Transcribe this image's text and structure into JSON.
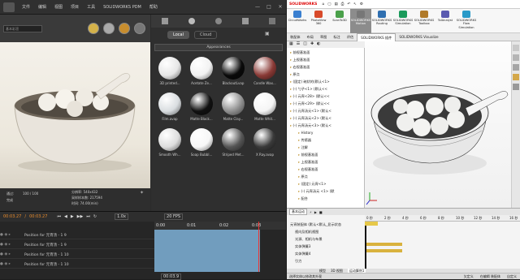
{
  "left_app": {
    "menu": [
      "文件",
      "编辑",
      "视图",
      "项目",
      "工具",
      "SOLIDWORKS PDM",
      "帮助"
    ],
    "window_controls": [
      "—",
      "□",
      "✕"
    ],
    "style_dropdown": "基本彩渲",
    "library": {
      "tabs": [
        "Local",
        "Cloud"
      ],
      "section": "Appearances",
      "materials": [
        {
          "label": "3D printed...",
          "color": "#e6e6e6"
        },
        {
          "label": "Acetate Ze...",
          "color": "#f2f2f2"
        },
        {
          "label": "BlackoutLvap",
          "color": "#0a0a0a"
        },
        {
          "label": "Candle Wax...",
          "color": "#8a3a36"
        },
        {
          "label": "Film.avap",
          "color": "#d9dde0"
        },
        {
          "label": "Matte Black...",
          "color": "#111111"
        },
        {
          "label": "Matte Clay...",
          "color": "#8f8f8f"
        },
        {
          "label": "Matte Whit...",
          "color": "#f5f5f5"
        },
        {
          "label": "Smooth Wh...",
          "color": "#dddddd"
        },
        {
          "label": "Soap Bubbl...",
          "color": "#f7f7f7"
        },
        {
          "label": "Striped Met...",
          "color": "#555555"
        },
        {
          "label": "X Ray.avap",
          "color": "#3a3a3a"
        }
      ]
    },
    "status": {
      "pass_label": "通过:",
      "pass_value": "100 / 100",
      "done": "完成",
      "resolution": "分辨率: 540x432",
      "samples": "采样样本数: 217594",
      "time": "时间: 74.00(min)"
    },
    "timeline": {
      "time_start": "00:03.27",
      "time_end": "00:03.27",
      "zoom": "1.0x",
      "fps": "20 FPS",
      "ticks": [
        "0:00",
        "0:01",
        "0:02",
        "0:03"
      ],
      "rows": [
        "Position for 元宵汤 - 1 9",
        "Position for 元宵汤 - 1 9",
        "Position for 元宵汤 - 1 10",
        "Position for 元宵汤 - 1 10"
      ],
      "bottom_time": "00:03.9"
    }
  },
  "right_app": {
    "title": "SOLIDWORKS",
    "search_hint": "搜索命令",
    "ribbon": [
      {
        "label": "CircuitWorks",
        "color": "#3a7fd0"
      },
      {
        "label": "PhotoView 360",
        "color": "#d84a2a"
      },
      {
        "label": "ScanTo3D",
        "color": "#4aa04a"
      },
      {
        "label": "SOLIDWORKS Motion",
        "color": "#777777",
        "active": true
      },
      {
        "label": "SOLIDWORKS Routing",
        "color": "#2f6fb0"
      },
      {
        "label": "SOLIDWORKS Simulation",
        "color": "#1a9a5a"
      },
      {
        "label": "SOLIDWORKS Toolbox",
        "color": "#b07a2a"
      },
      {
        "label": "TolAnalyst",
        "color": "#5a5ab0"
      },
      {
        "label": "SOLIDWORKS Flow Simulation",
        "color": "#2a9ac8"
      }
    ],
    "tabs": [
      "装配体",
      "布局",
      "草图",
      "标注",
      "评估",
      "SOLIDWORKS 插件",
      "SOLIDWORKS Visualize"
    ],
    "active_tab": "SOLIDWORKS 插件",
    "tree": [
      "前视基准面",
      "上视基准面",
      "右视基准面",
      "原点",
      "(固定) 碗状的(默认<1>",
      "(-) 勺子<1> (默认<<",
      "(-) 元宵<28> (默认<<",
      "(-) 元宵<29> (默认<<",
      "(-) 元宵汤元<1> (默认<",
      "(-) 元宵汤元<2> (默认<",
      "(-) 元宵汤元<3> (默认<",
      "History",
      "传感器",
      "注解",
      "前视基准面",
      "上视基准面",
      "右视基准面",
      "原点",
      "(固定) 元宵<1>",
      "(-) 元宵汤元 <1> (默",
      "配合"
    ],
    "motion": {
      "type": "基本运动",
      "ticks": [
        "0 秒",
        "2 秒",
        "4 秒",
        "6 秒",
        "8 秒",
        "10 秒",
        "12 秒",
        "14 秒",
        "16 秒"
      ],
      "rows": [
        "元宵装配体 (默认<默认_显示状态",
        "视向及相机视图",
        "光源、相机与布景",
        "实体弹簧3",
        "实体弹簧4",
        "引力"
      ]
    },
    "bottom_tabs": [
      "模型",
      "3D 视图",
      "运动算例1"
    ],
    "status": {
      "left": "选择实体以修改其外观",
      "right": [
        "欠定义",
        "在编辑 装配体",
        "自定义"
      ]
    }
  }
}
